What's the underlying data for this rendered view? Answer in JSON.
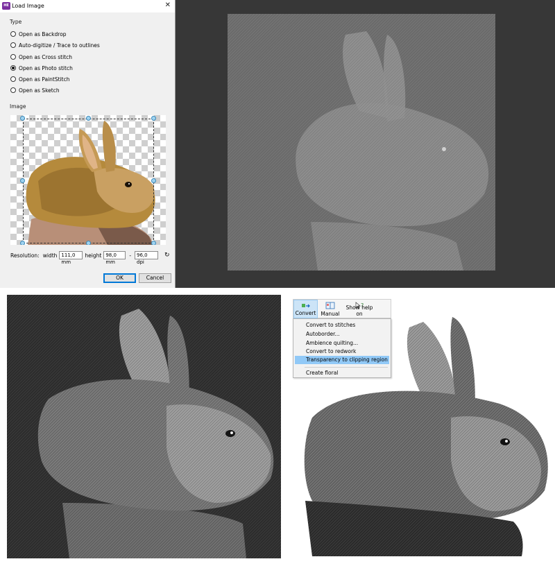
{
  "dialog": {
    "title": "Load Image",
    "close_glyph": "✕",
    "app_icon_text": "HE",
    "type_group_label": "Type",
    "options": [
      {
        "label": "Open as Backdrop",
        "selected": false
      },
      {
        "label": "Auto-digitize / Trace to outlines",
        "selected": false
      },
      {
        "label": "Open as Cross stitch",
        "selected": false
      },
      {
        "label": "Open as Photo stitch",
        "selected": true
      },
      {
        "label": "Open as PaintStitch",
        "selected": false
      },
      {
        "label": "Open as Sketch",
        "selected": false
      }
    ],
    "image_group_label": "Image",
    "resolution_label": "Resolution:",
    "width_label": "width",
    "width_value": "111,0 mm",
    "height_label": "height",
    "height_value": "98,0 mm",
    "dpi_separator": "-",
    "dpi_value": "96,0 dpi",
    "reset_icon": "↻",
    "ok_label": "OK",
    "cancel_label": "Cancel"
  },
  "ribbon": {
    "buttons": [
      {
        "label": "Convert",
        "icon": "convert-icon"
      },
      {
        "label": "Manual",
        "icon": "manual-icon"
      },
      {
        "label": "Show help on",
        "icon": "help-pointer-icon"
      }
    ]
  },
  "convert_menu": {
    "items": [
      {
        "label": "Convert to stitches",
        "highlighted": false
      },
      {
        "label": "Autoborder...",
        "highlighted": false
      },
      {
        "label": "Ambience quilting...",
        "highlighted": false
      },
      {
        "label": "Convert to redwork",
        "highlighted": false
      },
      {
        "label": "Transparency to clipping region",
        "highlighted": true
      },
      {
        "label": "Create floral",
        "highlighted": false
      }
    ]
  },
  "colors": {
    "canvas_dark": "#373737",
    "highlight": "#91c9f7",
    "accent": "#0078d7"
  }
}
